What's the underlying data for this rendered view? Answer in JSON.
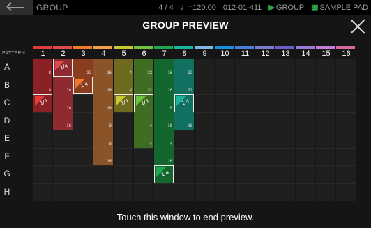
{
  "topbar": {
    "mode": "GROUP",
    "time_signature": "4 / 4",
    "tempo": "♩=120.00",
    "position": "012-01-411",
    "play_target": "GROUP",
    "pad_mode": "SAMPLE PAD"
  },
  "title": "GROUP PREVIEW",
  "pattern_label": "PATTERN",
  "rows": [
    "A",
    "B",
    "C",
    "D",
    "E",
    "F",
    "G",
    "H"
  ],
  "columns": [
    {
      "num": "1",
      "color": "#e23b3b"
    },
    {
      "num": "2",
      "color": "#e04a4a"
    },
    {
      "num": "3",
      "color": "#f07a2a"
    },
    {
      "num": "4",
      "color": "#f0a14a"
    },
    {
      "num": "5",
      "color": "#c8c830"
    },
    {
      "num": "6",
      "color": "#6cc440"
    },
    {
      "num": "7",
      "color": "#1fa84f"
    },
    {
      "num": "8",
      "color": "#1ab59a"
    },
    {
      "num": "9",
      "color": "#7fb9e8"
    },
    {
      "num": "10",
      "color": "#1a8fe0"
    },
    {
      "num": "11",
      "color": "#4a7fd8"
    },
    {
      "num": "12",
      "color": "#7b7bd0"
    },
    {
      "num": "13",
      "color": "#6a60c8"
    },
    {
      "num": "14",
      "color": "#9a7bd8"
    },
    {
      "num": "15",
      "color": "#c87bd8"
    },
    {
      "num": "16",
      "color": "#d86aa0"
    }
  ],
  "cells": [
    {
      "col": 0,
      "row": 0,
      "label": "8",
      "color": "#8b2025"
    },
    {
      "col": 0,
      "row": 1,
      "label": "8",
      "color": "#8b2025"
    },
    {
      "col": 0,
      "row": 2,
      "label": "1/4",
      "color": "#8b2025",
      "selected": true
    },
    {
      "col": 1,
      "row": 0,
      "label": "1/4",
      "color": "#8e2a30",
      "selected": true
    },
    {
      "col": 1,
      "row": 1,
      "label": "16",
      "color": "#8e2a30"
    },
    {
      "col": 1,
      "row": 2,
      "label": "16",
      "color": "#8e2a30"
    },
    {
      "col": 1,
      "row": 3,
      "label": "16",
      "color": "#8e2a30"
    },
    {
      "col": 2,
      "row": 0,
      "label": "32",
      "color": "#8a3d1f"
    },
    {
      "col": 2,
      "row": 1,
      "label": "1/4",
      "color": "#8a3d1f",
      "selected": true
    },
    {
      "col": 3,
      "row": 0,
      "label": "16",
      "color": "#8a5428"
    },
    {
      "col": 3,
      "row": 1,
      "label": "16",
      "color": "#8a5428"
    },
    {
      "col": 3,
      "row": 2,
      "label": "16",
      "color": "#8a5428"
    },
    {
      "col": 3,
      "row": 3,
      "label": "8",
      "color": "#8a5428"
    },
    {
      "col": 3,
      "row": 4,
      "label": "8",
      "color": "#8a5428"
    },
    {
      "col": 3,
      "row": 5,
      "label": "16",
      "color": "#8a5428"
    },
    {
      "col": 4,
      "row": 0,
      "label": "4",
      "color": "#6e6a1f"
    },
    {
      "col": 4,
      "row": 1,
      "label": "4",
      "color": "#6e6a1f"
    },
    {
      "col": 4,
      "row": 2,
      "label": "1/4",
      "color": "#6e6a1f",
      "selected": true
    },
    {
      "col": 5,
      "row": 0,
      "label": "32",
      "color": "#3f6e22"
    },
    {
      "col": 5,
      "row": 1,
      "label": "32",
      "color": "#3f6e22"
    },
    {
      "col": 5,
      "row": 2,
      "label": "1/4",
      "color": "#3f6e22",
      "selected": true
    },
    {
      "col": 5,
      "row": 3,
      "label": "4",
      "color": "#3f6e22"
    },
    {
      "col": 5,
      "row": 4,
      "label": "4",
      "color": "#3f6e22"
    },
    {
      "col": 6,
      "row": 0,
      "label": "16",
      "color": "#13662e"
    },
    {
      "col": 6,
      "row": 1,
      "label": "16",
      "color": "#13662e"
    },
    {
      "col": 6,
      "row": 2,
      "label": "8",
      "color": "#13662e"
    },
    {
      "col": 6,
      "row": 3,
      "label": "16",
      "color": "#13662e"
    },
    {
      "col": 6,
      "row": 4,
      "label": "4",
      "color": "#13662e"
    },
    {
      "col": 6,
      "row": 5,
      "label": "16",
      "color": "#13662e"
    },
    {
      "col": 6,
      "row": 6,
      "label": "1/4",
      "color": "#13662e",
      "selected": true
    },
    {
      "col": 7,
      "row": 0,
      "label": "32",
      "color": "#127060"
    },
    {
      "col": 7,
      "row": 1,
      "label": "32",
      "color": "#127060"
    },
    {
      "col": 7,
      "row": 2,
      "label": "1/4",
      "color": "#127060",
      "selected": true
    },
    {
      "col": 7,
      "row": 3,
      "label": "16",
      "color": "#127060"
    }
  ],
  "footer": "Touch this window to end preview."
}
